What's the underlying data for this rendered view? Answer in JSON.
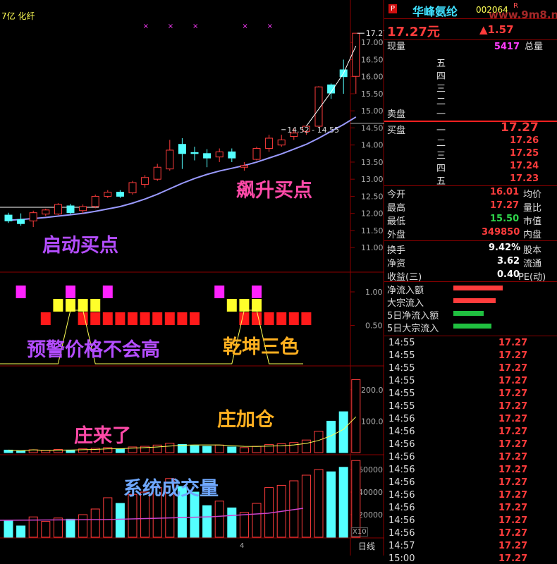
{
  "header": {
    "left_label": "7亿 化纤",
    "stock_name": "华峰氨纶",
    "stock_code": "002064",
    "r_mark": "R",
    "watermark": "www.9m8.net",
    "p_badge": "P"
  },
  "price": {
    "last": "17.27元",
    "change": "▲1.57"
  },
  "volume_row": {
    "label1": "现量",
    "value": "5417",
    "label2": "总量"
  },
  "sell_book": {
    "title": "卖盘",
    "levels": [
      "五",
      "四",
      "三",
      "二",
      "一"
    ]
  },
  "buy_book": {
    "title": "买盘",
    "levels": [
      {
        "label": "一",
        "price": "17.27"
      },
      {
        "label": "二",
        "price": "17.26"
      },
      {
        "label": "三",
        "price": "17.25"
      },
      {
        "label": "四",
        "price": "17.24"
      },
      {
        "label": "五",
        "price": "17.23"
      }
    ]
  },
  "stats": [
    {
      "label": "今开",
      "value": "16.01",
      "right": "均价",
      "color": "red"
    },
    {
      "label": "最高",
      "value": "17.27",
      "right": "量比",
      "color": "red"
    },
    {
      "label": "最低",
      "value": "15.50",
      "right": "市值",
      "color": "green"
    },
    {
      "label": "外盘",
      "value": "349850",
      "right": "内盘",
      "color": "red"
    }
  ],
  "stats2": [
    {
      "label": "换手",
      "value": "9.42%",
      "right": "股本"
    },
    {
      "label": "净资",
      "value": "3.62",
      "right": "流通"
    },
    {
      "label": "收益(三)",
      "value": "0.40",
      "right": "PE(动)"
    }
  ],
  "flows": [
    {
      "label": "净流入额",
      "color": "#ff3c3c",
      "bar_fraction": 0.95
    },
    {
      "label": "大宗流入",
      "color": "#ff3c3c",
      "bar_fraction": 0.82
    },
    {
      "label": "5日净流入额",
      "color": "#20c040",
      "bar_fraction": 0.6
    },
    {
      "label": "5日大宗流入",
      "color": "#20c040",
      "bar_fraction": 0.75
    }
  ],
  "ticks": [
    {
      "time": "14:55",
      "price": "17.27"
    },
    {
      "time": "14:55",
      "price": "17.27"
    },
    {
      "time": "14:55",
      "price": "17.27"
    },
    {
      "time": "14:55",
      "price": "17.27"
    },
    {
      "time": "14:55",
      "price": "17.27"
    },
    {
      "time": "14:55",
      "price": "17.27"
    },
    {
      "time": "14:56",
      "price": "17.27"
    },
    {
      "time": "14:56",
      "price": "17.27"
    },
    {
      "time": "14:56",
      "price": "17.27"
    },
    {
      "time": "14:56",
      "price": "17.27"
    },
    {
      "time": "14:56",
      "price": "17.27"
    },
    {
      "time": "14:56",
      "price": "17.27"
    },
    {
      "time": "14:56",
      "price": "17.27"
    },
    {
      "time": "14:56",
      "price": "17.27"
    },
    {
      "time": "14:56",
      "price": "17.27"
    },
    {
      "time": "14:56",
      "price": "17.27"
    },
    {
      "time": "14:57",
      "price": "17.27"
    },
    {
      "time": "15:00",
      "price": "17.27"
    }
  ],
  "overlays": {
    "start_buy": "启动买点",
    "surge_buy": "飙升买点",
    "warning": "预警价格不会高",
    "qiankun": "乾坤三色",
    "dealer_add": "庄加仓",
    "dealer_came": "庄来了",
    "system_vol": "系统成交量"
  },
  "axis": {
    "price_ticks": [
      "17.00",
      "16.50",
      "16.00",
      "15.50",
      "15.00",
      "14.50",
      "14.00",
      "13.50",
      "13.00",
      "12.50",
      "12.00",
      "11.50",
      "11.00"
    ],
    "ind_ticks": [
      "1.00",
      "0.50"
    ],
    "vol_ticks": [
      "200.0",
      "100.0"
    ],
    "sysvol_ticks": [
      "60000",
      "40000",
      "20000"
    ],
    "x10_label": "X10",
    "period": "日线",
    "month_mark": "4",
    "price_marker_high": "17.27",
    "price_marker_mid": "14.52 - 14.55"
  },
  "chart_data": {
    "type": "candlestick",
    "candles": [
      {
        "o": 11.78,
        "c": 11.95,
        "h": 12.02,
        "l": 11.72,
        "up": false
      },
      {
        "o": 11.82,
        "c": 11.7,
        "h": 12.0,
        "l": 11.64,
        "up": false
      },
      {
        "o": 11.78,
        "c": 12.02,
        "h": 12.08,
        "l": 11.6,
        "up": true
      },
      {
        "o": 11.98,
        "c": 12.1,
        "h": 12.14,
        "l": 11.92,
        "up": true
      },
      {
        "o": 11.98,
        "c": 12.26,
        "h": 12.3,
        "l": 11.95,
        "up": true
      },
      {
        "o": 12.22,
        "c": 12.02,
        "h": 12.28,
        "l": 11.98,
        "up": false
      },
      {
        "o": 12.08,
        "c": 12.2,
        "h": 12.26,
        "l": 12.0,
        "up": true
      },
      {
        "o": 12.2,
        "c": 12.5,
        "h": 12.55,
        "l": 12.15,
        "up": true
      },
      {
        "o": 12.5,
        "c": 12.62,
        "h": 12.68,
        "l": 12.45,
        "up": true
      },
      {
        "o": 12.62,
        "c": 12.5,
        "h": 12.68,
        "l": 12.45,
        "up": false
      },
      {
        "o": 12.6,
        "c": 12.9,
        "h": 12.95,
        "l": 12.55,
        "up": true
      },
      {
        "o": 12.85,
        "c": 13.05,
        "h": 13.12,
        "l": 12.75,
        "up": true
      },
      {
        "o": 13.0,
        "c": 13.35,
        "h": 13.45,
        "l": 12.95,
        "up": true
      },
      {
        "o": 13.3,
        "c": 13.85,
        "h": 14.15,
        "l": 13.25,
        "up": true
      },
      {
        "o": 14.02,
        "c": 13.75,
        "h": 14.2,
        "l": 13.3,
        "up": false
      },
      {
        "o": 13.78,
        "c": 13.75,
        "h": 13.95,
        "l": 13.55,
        "up": false
      },
      {
        "o": 13.75,
        "c": 13.62,
        "h": 13.88,
        "l": 13.35,
        "up": false
      },
      {
        "o": 13.65,
        "c": 13.8,
        "h": 13.9,
        "l": 13.5,
        "up": true
      },
      {
        "o": 13.8,
        "c": 13.62,
        "h": 13.9,
        "l": 13.5,
        "up": false
      },
      {
        "o": 13.35,
        "c": 13.4,
        "h": 13.5,
        "l": 13.25,
        "up": true
      },
      {
        "o": 13.58,
        "c": 13.9,
        "h": 13.95,
        "l": 13.55,
        "up": true
      },
      {
        "o": 13.9,
        "c": 14.2,
        "h": 14.3,
        "l": 13.8,
        "up": true
      },
      {
        "o": 14.0,
        "c": 14.15,
        "h": 14.3,
        "l": 13.95,
        "up": true
      },
      {
        "o": 14.25,
        "c": 14.35,
        "h": 14.5,
        "l": 14.15,
        "up": true
      },
      {
        "o": 14.4,
        "c": 14.55,
        "h": 14.55,
        "l": 14.3,
        "up": true
      },
      {
        "o": 14.55,
        "c": 15.7,
        "h": 15.72,
        "l": 14.55,
        "up": true
      },
      {
        "o": 15.76,
        "c": 15.52,
        "h": 15.8,
        "l": 15.35,
        "up": false
      },
      {
        "o": 16.0,
        "c": 16.2,
        "h": 16.5,
        "l": 15.5,
        "up": false
      },
      {
        "o": 16.01,
        "c": 17.27,
        "h": 17.27,
        "l": 15.5,
        "up": true
      }
    ],
    "ma": [
      11.8,
      11.82,
      11.85,
      11.88,
      11.92,
      11.96,
      12.0,
      12.06,
      12.13,
      12.2,
      12.3,
      12.42,
      12.56,
      12.72,
      12.88,
      13.02,
      13.14,
      13.24,
      13.32,
      13.4,
      13.5,
      13.62,
      13.74,
      13.88,
      14.02,
      14.2,
      14.4,
      14.6,
      14.82
    ],
    "volume": [
      8,
      6,
      9,
      7,
      10,
      8,
      12,
      14,
      16,
      12,
      18,
      20,
      24,
      30,
      26,
      22,
      20,
      24,
      18,
      16,
      20,
      26,
      28,
      32,
      40,
      68,
      100,
      130,
      232
    ],
    "sys_volume": [
      15000,
      10000,
      18000,
      14000,
      17000,
      16000,
      20000,
      25000,
      35000,
      30000,
      38000,
      40000,
      44000,
      52000,
      45000,
      40000,
      28000,
      32000,
      26000,
      22000,
      30000,
      44000,
      46000,
      50000,
      55000,
      60000,
      58000,
      62000,
      68000
    ],
    "price_range": [
      10.9,
      17.5
    ],
    "vol_range": [
      0,
      240
    ],
    "sysvol_range": [
      0,
      70000
    ]
  }
}
